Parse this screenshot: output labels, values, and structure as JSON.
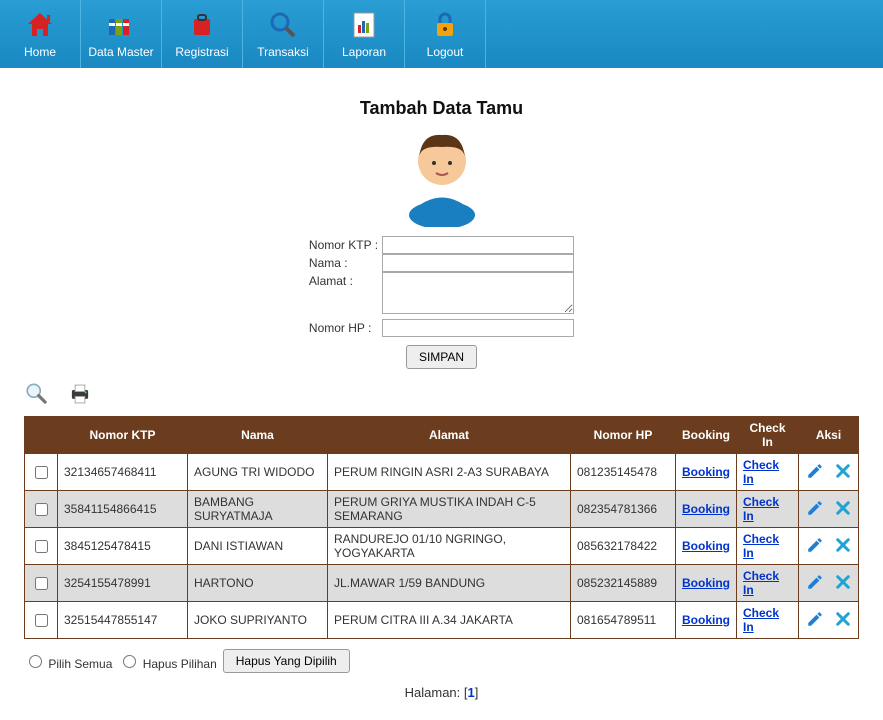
{
  "nav": {
    "home": "Home",
    "data_master": "Data Master",
    "registrasi": "Registrasi",
    "transaksi": "Transaksi",
    "laporan": "Laporan",
    "logout": "Logout"
  },
  "page_title": "Tambah Data Tamu",
  "form": {
    "labels": {
      "ktp": "Nomor KTP :",
      "nama": "Nama :",
      "alamat": "Alamat :",
      "hp": "Nomor HP :"
    },
    "values": {
      "ktp": "",
      "nama": "",
      "alamat": "",
      "hp": ""
    },
    "save_btn": "SIMPAN"
  },
  "table": {
    "headers": {
      "ktp": "Nomor KTP",
      "nama": "Nama",
      "alamat": "Alamat",
      "hp": "Nomor HP",
      "booking": "Booking",
      "checkin": "Check In",
      "aksi": "Aksi"
    },
    "rows": [
      {
        "ktp": "32134657468411",
        "nama": "AGUNG TRI WIDODO",
        "alamat": "PERUM RINGIN ASRI 2-A3 SURABAYA",
        "hp": "081235145478"
      },
      {
        "ktp": "35841154866415",
        "nama": "BAMBANG SURYATMAJA",
        "alamat": "PERUM GRIYA MUSTIKA INDAH C-5 SEMARANG",
        "hp": "082354781366"
      },
      {
        "ktp": "3845125478415",
        "nama": "DANI ISTIAWAN",
        "alamat": "RANDUREJO 01/10 NGRINGO, YOGYAKARTA",
        "hp": "085632178422"
      },
      {
        "ktp": "3254155478991",
        "nama": "HARTONO",
        "alamat": "JL.MAWAR 1/59 BANDUNG",
        "hp": "085232145889"
      },
      {
        "ktp": "32515447855147",
        "nama": "JOKO SUPRIYANTO",
        "alamat": "PERUM CITRA III A.34 JAKARTA",
        "hp": "081654789511"
      }
    ],
    "booking_link": "Booking",
    "checkin_link": "Check In"
  },
  "footer": {
    "pilih_semua": "Pilih Semua",
    "hapus_pilihan": "Hapus Pilihan",
    "hapus_btn": "Hapus Yang Dipilih",
    "halaman_label": "Halaman: ",
    "page": "1"
  }
}
